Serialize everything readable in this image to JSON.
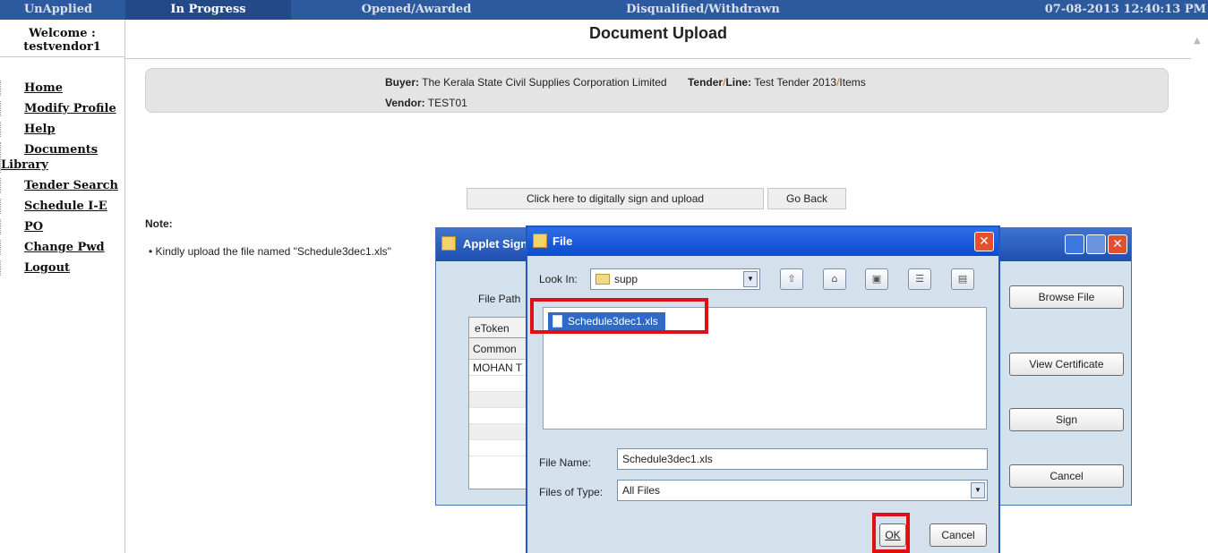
{
  "tabs": [
    {
      "label": "UnApplied"
    },
    {
      "label": "In Progress"
    },
    {
      "label": "Opened/Awarded"
    },
    {
      "label": "Disqualified/Withdrawn"
    }
  ],
  "datetime": "07-08-2013 12:40:13 PM",
  "sidebar": {
    "welcome_label": "Welcome :",
    "username": "testvendor1",
    "items": [
      {
        "label": "Home"
      },
      {
        "label": "Modify Profile"
      },
      {
        "label": "Help"
      },
      {
        "label_line1": "Documents",
        "label_line2": "Library"
      },
      {
        "label": "Tender Search"
      },
      {
        "label": "Schedule I-E"
      },
      {
        "label": "PO"
      },
      {
        "label": "Change Pwd"
      },
      {
        "label": "Logout"
      }
    ]
  },
  "main": {
    "title": "Document Upload",
    "buyer_label": "Buyer:",
    "buyer_value": "The Kerala State Civil Supplies Corporation Limited",
    "tender_label": "Tender",
    "slash": "/",
    "line_label": "Line:",
    "tender_value": "Test Tender 2013",
    "line_value": "Items",
    "vendor_label": "Vendor:",
    "vendor_value": "TEST01",
    "sign_upload_button": "Click here to digitally sign and upload",
    "go_back_button": "Go Back",
    "note_title": "Note:",
    "note_item": "Kindly upload the file named \"Schedule3dec1.xls\""
  },
  "applet": {
    "title": "Applet Sign",
    "file_path_label": "File Path",
    "tab_label": "eToken",
    "table_header": "Common",
    "table_row": "MOHAN T",
    "browse_button": "Browse File",
    "view_cert_button": "View Certificate",
    "sign_button": "Sign",
    "cancel_button": "Cancel"
  },
  "file_dialog": {
    "title": "File",
    "look_in_label": "Look In:",
    "look_in_value": "supp",
    "selected_file": "Schedule3dec1.xls",
    "file_name_label": "File Name:",
    "file_name_value": "Schedule3dec1.xls",
    "files_of_type_label": "Files of Type:",
    "files_of_type_value": "All Files",
    "ok_button": "OK",
    "cancel_button": "Cancel"
  },
  "colors": {
    "topbar": "#2d5a9e",
    "highlight": "#e01010",
    "selection": "#2f6ac8"
  }
}
